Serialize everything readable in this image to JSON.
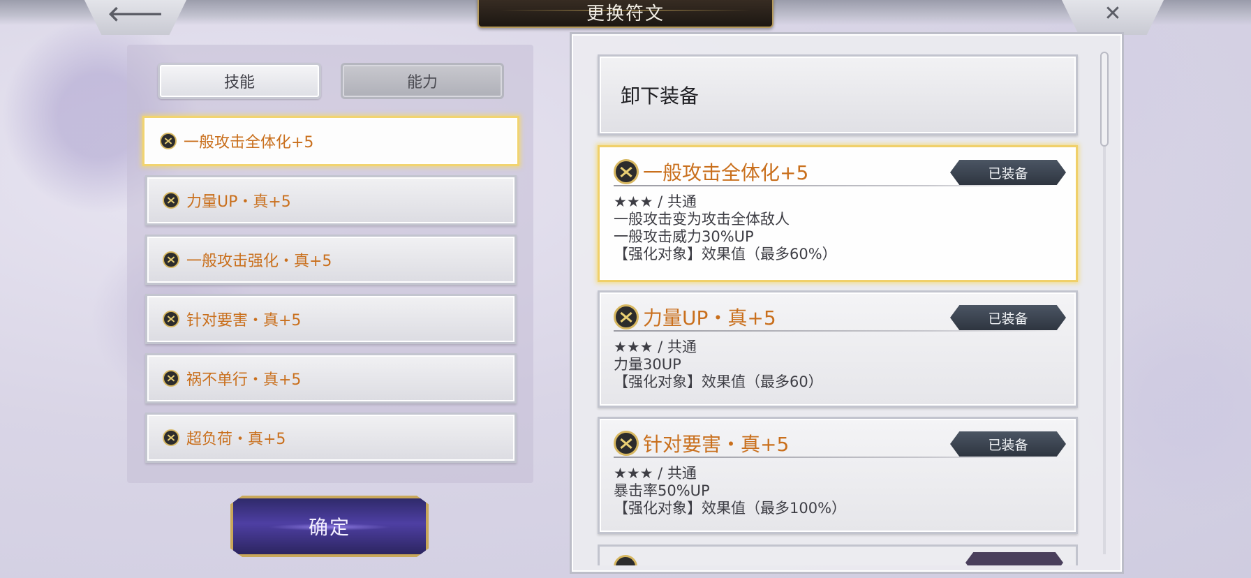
{
  "header": {
    "title": "更换符文",
    "back_glyph": "🡐",
    "close_glyph": "✕"
  },
  "left": {
    "tabs": [
      {
        "label": "技能",
        "active": true
      },
      {
        "label": "能力",
        "active": false
      }
    ],
    "runes": [
      {
        "name": "一般攻击全体化+5",
        "selected": true
      },
      {
        "name": "力量UP・真+5"
      },
      {
        "name": "一般攻击强化・真+5"
      },
      {
        "name": "针对要害・真+5"
      },
      {
        "name": "祸不单行・真+5"
      },
      {
        "name": "超负荷・真+5"
      }
    ],
    "confirm_label": "确定"
  },
  "right": {
    "unequip_label": "卸下装备",
    "cards": [
      {
        "title": "一般攻击全体化+5",
        "badge": "已装备",
        "selected": true,
        "lines": [
          "★★★ / 共通",
          "一般攻击变为攻击全体敌人",
          "一般攻击威力30%UP",
          "【强化对象】效果值（最多60%）"
        ]
      },
      {
        "title": "力量UP・真+5",
        "badge": "已装备",
        "lines": [
          "★★★ / 共通",
          "力量30UP",
          "【强化对象】效果值（最多60）"
        ]
      },
      {
        "title": "针对要害・真+5",
        "badge": "已装备",
        "lines": [
          "★★★ / 共通",
          "暴击率50%UP",
          "【强化对象】效果值（最多100%）"
        ]
      }
    ]
  },
  "colors": {
    "rune_name": "#c96f1c",
    "selected_border": "#f0d06a",
    "confirm_bg": "#4e3fa3",
    "badge_bg": "#2e3540"
  },
  "icons": {
    "rune": "rune-sigil-icon",
    "back": "back-arrow-icon",
    "close": "close-icon"
  }
}
